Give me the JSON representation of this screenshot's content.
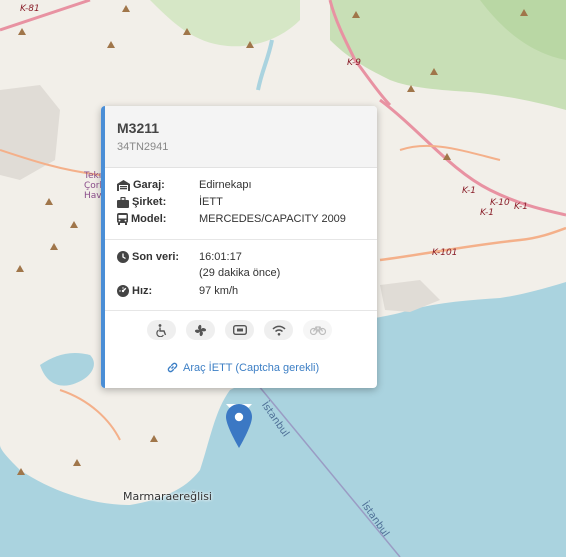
{
  "map": {
    "labels": {
      "road_k81": "K-81",
      "road_k9": "K-9",
      "road_k1a": "K-1",
      "road_k10": "K-10",
      "road_k1b": "K-1",
      "road_k1c": "K-1",
      "road_k101": "K-101",
      "tekirdag_1": "Tekı",
      "tekirdag_2": "Çorlu",
      "tekirdag_3": "Hava",
      "istanbul_1": "İstanbul",
      "istanbul_2": "İstanbul",
      "town": "Marmaraereğlisi"
    },
    "colors": {
      "water": "#aad3df",
      "land": "#f2efe9",
      "forest": "#c8dfb6",
      "road": "#e892a2",
      "peak": "#a0764a"
    }
  },
  "popup": {
    "vehicle_id": "M3211",
    "plate": "34TN2941",
    "garage_label": "Garaj:",
    "garage_value": "Edirnekapı",
    "company_label": "Şirket:",
    "company_value": "İETT",
    "model_label": "Model:",
    "model_value": "MERCEDES/CAPACITY 2009",
    "last_data_label": "Son veri:",
    "last_data_time": "16:01:17",
    "last_data_ago": "(29 dakika önce)",
    "speed_label": "Hız:",
    "speed_value": "97 km/h",
    "features": [
      {
        "icon": "wheelchair-icon",
        "enabled": true
      },
      {
        "icon": "fan-icon",
        "enabled": true
      },
      {
        "icon": "usb-icon",
        "enabled": true
      },
      {
        "icon": "wifi-icon",
        "enabled": true
      },
      {
        "icon": "bicycle-icon",
        "enabled": false
      }
    ],
    "link_text": "Araç İETT (Captcha gerekli)",
    "accent_color": "#4a8ed6",
    "link_color": "#3d7fc5"
  },
  "marker": {
    "icon": "map-marker-icon",
    "color": "#3b78c4"
  }
}
